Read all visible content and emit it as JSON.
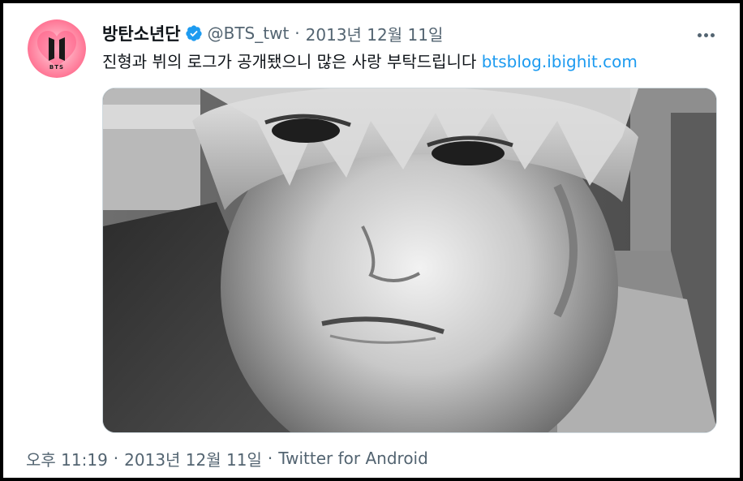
{
  "tweet": {
    "display_name": "방탄소년단",
    "verified_icon": "verified-badge-icon",
    "handle": "@BTS_twt",
    "separator": "·",
    "date": "2013년 12월 11일",
    "text": "진형과 뷔의 로그가 공개됐으니 많은 사랑 부탁드립니다",
    "link": "btsblog.ibighit.com",
    "media_description_icon": "photo",
    "timestamp_time": "오후 11:19",
    "timestamp_date": "2013년 12월 11일",
    "source": "Twitter for Android"
  },
  "avatar": {
    "logo_text": "BTS",
    "background_color": "#ff7b9a"
  },
  "colors": {
    "text_primary": "#0f1419",
    "text_secondary": "#536471",
    "link": "#1d9bf0",
    "verified": "#1d9bf0",
    "border": "#cfd9de"
  }
}
